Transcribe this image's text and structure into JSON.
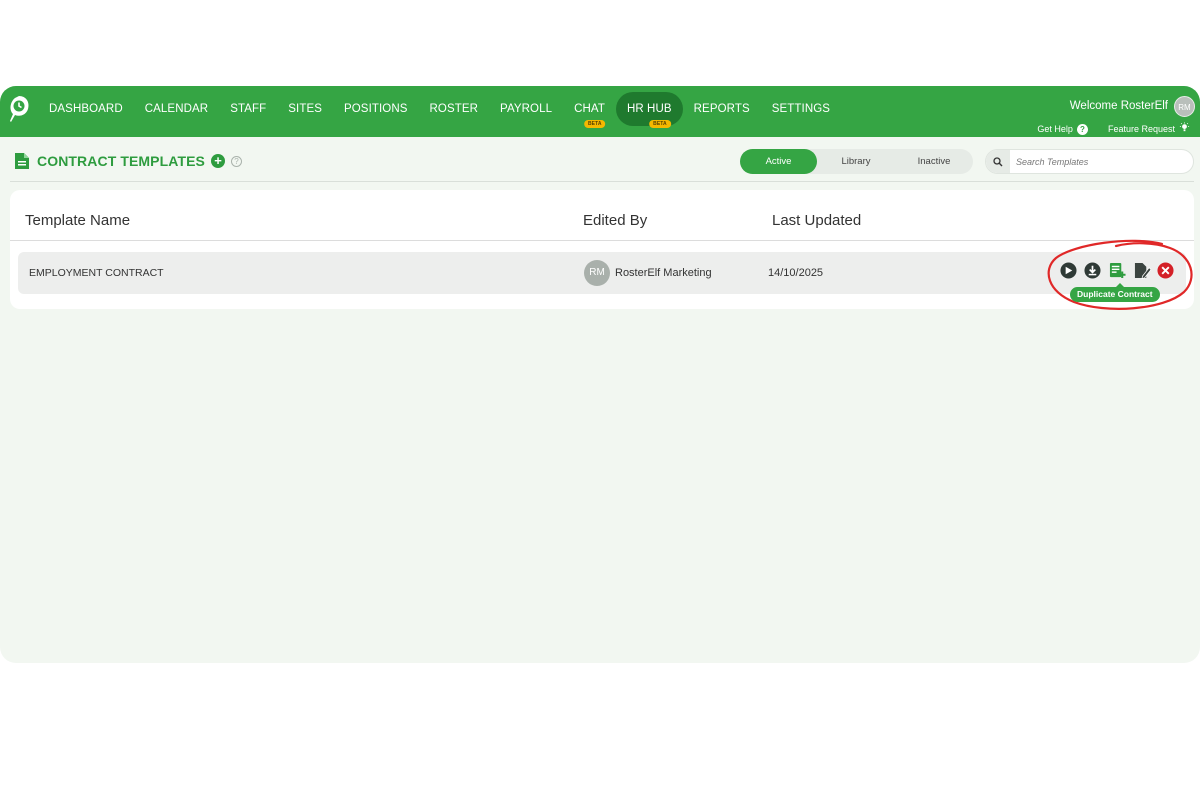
{
  "nav": {
    "items": [
      {
        "label": "DASHBOARD"
      },
      {
        "label": "CALENDAR"
      },
      {
        "label": "STAFF"
      },
      {
        "label": "SITES"
      },
      {
        "label": "POSITIONS"
      },
      {
        "label": "ROSTER"
      },
      {
        "label": "PAYROLL"
      },
      {
        "label": "CHAT",
        "badge": "BETA"
      },
      {
        "label": "HR HUB",
        "badge": "BETA",
        "active": true
      },
      {
        "label": "REPORTS"
      },
      {
        "label": "SETTINGS"
      }
    ],
    "welcome": "Welcome RosterElf",
    "avatar_initials": "RM",
    "get_help": "Get Help",
    "feature_request": "Feature Request"
  },
  "page": {
    "title": "CONTRACT TEMPLATES"
  },
  "tabs": [
    {
      "label": "Active",
      "active": true
    },
    {
      "label": "Library"
    },
    {
      "label": "Inactive"
    }
  ],
  "search": {
    "placeholder": "Search Templates",
    "value": ""
  },
  "table": {
    "columns": [
      "Template Name",
      "Edited By",
      "Last Updated"
    ],
    "rows": [
      {
        "name": "EMPLOYMENT CONTRACT",
        "editor_initials": "RM",
        "editor": "RosterElf Marketing",
        "updated": "14/10/2025"
      }
    ]
  },
  "actions": {
    "icons": [
      "send-icon",
      "download-icon",
      "duplicate-icon",
      "edit-icon",
      "delete-icon"
    ],
    "tooltip": "Duplicate Contract"
  },
  "colors": {
    "brand_green": "#35a544",
    "dark_green": "#1f7a2e",
    "beta_badge": "#f5b800",
    "delete_red": "#d42027",
    "highlight_red": "#e02828"
  }
}
